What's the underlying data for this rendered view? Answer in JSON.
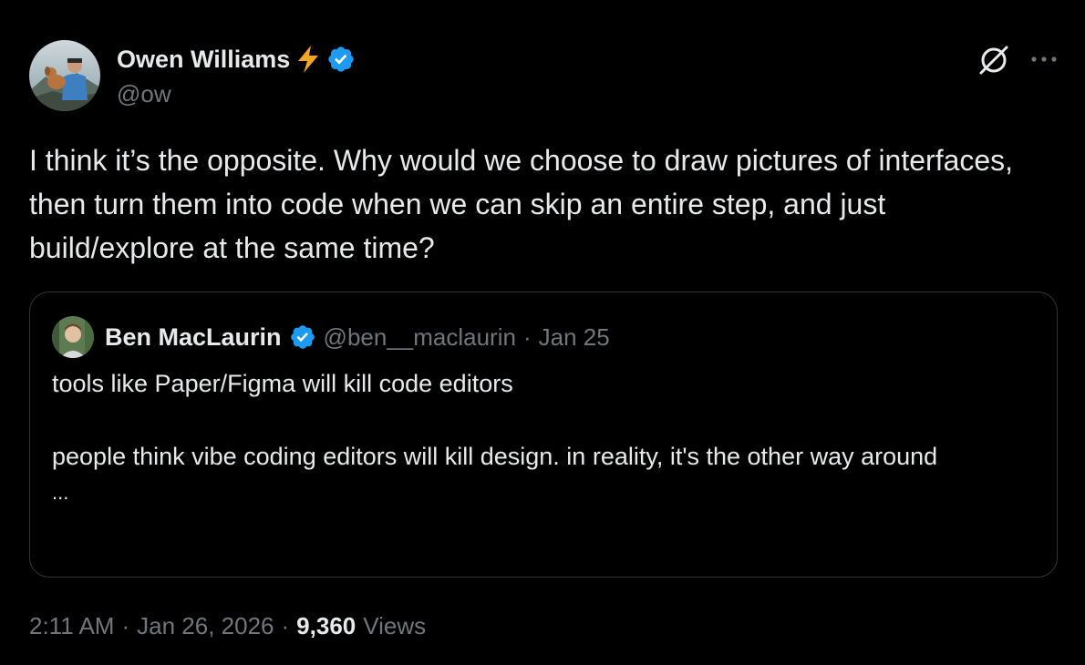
{
  "author": {
    "display_name": "Owen Williams",
    "emoji_name": "lightning-icon",
    "handle": "@ow",
    "verified": true
  },
  "tweet": {
    "text": "I think it’s the opposite. Why would we choose to draw pictures of interfaces, then turn them into code when we can skip an entire step, and just build/explore at the same time?"
  },
  "quote": {
    "display_name": "Ben MacLaurin",
    "handle": "@ben__maclaurin",
    "separator": "·",
    "date": "Jan 25",
    "paragraph_1": "tools like Paper/Figma will kill code editors",
    "paragraph_2": "people think vibe coding editors will kill design. in reality, it's the other way around",
    "ellipsis": "..."
  },
  "meta": {
    "time": "2:11 AM",
    "sep1": "·",
    "date": "Jan 26, 2026",
    "sep2": "·",
    "views_count": "9,360",
    "views_label": "Views"
  },
  "colors": {
    "background": "#000000",
    "text": "#e7e9ea",
    "muted": "#71767b",
    "verified_blue": "#1d9bf0",
    "lightning": "#f5a623",
    "border": "#333639"
  },
  "icons": {
    "grok": "grok-icon",
    "more": "more-icon",
    "verified": "verified-badge-icon"
  }
}
